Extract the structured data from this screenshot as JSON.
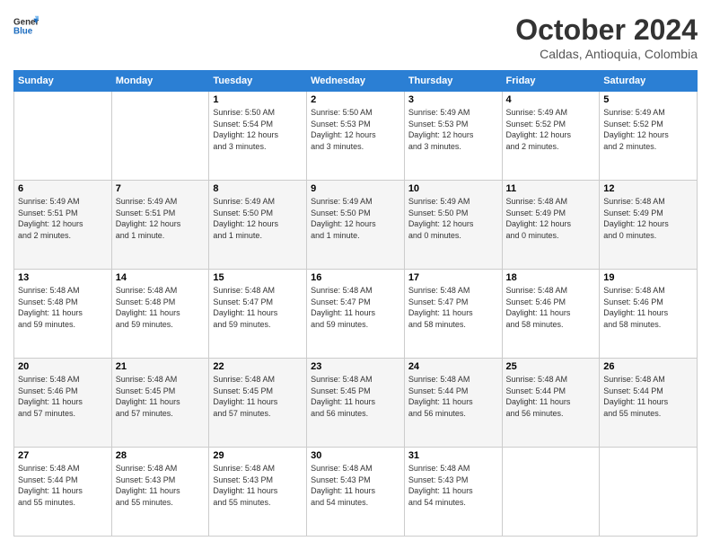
{
  "header": {
    "logo_line1": "General",
    "logo_line2": "Blue",
    "month_title": "October 2024",
    "location": "Caldas, Antioquia, Colombia"
  },
  "weekdays": [
    "Sunday",
    "Monday",
    "Tuesday",
    "Wednesday",
    "Thursday",
    "Friday",
    "Saturday"
  ],
  "weeks": [
    [
      {
        "day": "",
        "info": ""
      },
      {
        "day": "",
        "info": ""
      },
      {
        "day": "1",
        "info": "Sunrise: 5:50 AM\nSunset: 5:54 PM\nDaylight: 12 hours\nand 3 minutes."
      },
      {
        "day": "2",
        "info": "Sunrise: 5:50 AM\nSunset: 5:53 PM\nDaylight: 12 hours\nand 3 minutes."
      },
      {
        "day": "3",
        "info": "Sunrise: 5:49 AM\nSunset: 5:53 PM\nDaylight: 12 hours\nand 3 minutes."
      },
      {
        "day": "4",
        "info": "Sunrise: 5:49 AM\nSunset: 5:52 PM\nDaylight: 12 hours\nand 2 minutes."
      },
      {
        "day": "5",
        "info": "Sunrise: 5:49 AM\nSunset: 5:52 PM\nDaylight: 12 hours\nand 2 minutes."
      }
    ],
    [
      {
        "day": "6",
        "info": "Sunrise: 5:49 AM\nSunset: 5:51 PM\nDaylight: 12 hours\nand 2 minutes."
      },
      {
        "day": "7",
        "info": "Sunrise: 5:49 AM\nSunset: 5:51 PM\nDaylight: 12 hours\nand 1 minute."
      },
      {
        "day": "8",
        "info": "Sunrise: 5:49 AM\nSunset: 5:50 PM\nDaylight: 12 hours\nand 1 minute."
      },
      {
        "day": "9",
        "info": "Sunrise: 5:49 AM\nSunset: 5:50 PM\nDaylight: 12 hours\nand 1 minute."
      },
      {
        "day": "10",
        "info": "Sunrise: 5:49 AM\nSunset: 5:50 PM\nDaylight: 12 hours\nand 0 minutes."
      },
      {
        "day": "11",
        "info": "Sunrise: 5:48 AM\nSunset: 5:49 PM\nDaylight: 12 hours\nand 0 minutes."
      },
      {
        "day": "12",
        "info": "Sunrise: 5:48 AM\nSunset: 5:49 PM\nDaylight: 12 hours\nand 0 minutes."
      }
    ],
    [
      {
        "day": "13",
        "info": "Sunrise: 5:48 AM\nSunset: 5:48 PM\nDaylight: 11 hours\nand 59 minutes."
      },
      {
        "day": "14",
        "info": "Sunrise: 5:48 AM\nSunset: 5:48 PM\nDaylight: 11 hours\nand 59 minutes."
      },
      {
        "day": "15",
        "info": "Sunrise: 5:48 AM\nSunset: 5:47 PM\nDaylight: 11 hours\nand 59 minutes."
      },
      {
        "day": "16",
        "info": "Sunrise: 5:48 AM\nSunset: 5:47 PM\nDaylight: 11 hours\nand 59 minutes."
      },
      {
        "day": "17",
        "info": "Sunrise: 5:48 AM\nSunset: 5:47 PM\nDaylight: 11 hours\nand 58 minutes."
      },
      {
        "day": "18",
        "info": "Sunrise: 5:48 AM\nSunset: 5:46 PM\nDaylight: 11 hours\nand 58 minutes."
      },
      {
        "day": "19",
        "info": "Sunrise: 5:48 AM\nSunset: 5:46 PM\nDaylight: 11 hours\nand 58 minutes."
      }
    ],
    [
      {
        "day": "20",
        "info": "Sunrise: 5:48 AM\nSunset: 5:46 PM\nDaylight: 11 hours\nand 57 minutes."
      },
      {
        "day": "21",
        "info": "Sunrise: 5:48 AM\nSunset: 5:45 PM\nDaylight: 11 hours\nand 57 minutes."
      },
      {
        "day": "22",
        "info": "Sunrise: 5:48 AM\nSunset: 5:45 PM\nDaylight: 11 hours\nand 57 minutes."
      },
      {
        "day": "23",
        "info": "Sunrise: 5:48 AM\nSunset: 5:45 PM\nDaylight: 11 hours\nand 56 minutes."
      },
      {
        "day": "24",
        "info": "Sunrise: 5:48 AM\nSunset: 5:44 PM\nDaylight: 11 hours\nand 56 minutes."
      },
      {
        "day": "25",
        "info": "Sunrise: 5:48 AM\nSunset: 5:44 PM\nDaylight: 11 hours\nand 56 minutes."
      },
      {
        "day": "26",
        "info": "Sunrise: 5:48 AM\nSunset: 5:44 PM\nDaylight: 11 hours\nand 55 minutes."
      }
    ],
    [
      {
        "day": "27",
        "info": "Sunrise: 5:48 AM\nSunset: 5:44 PM\nDaylight: 11 hours\nand 55 minutes."
      },
      {
        "day": "28",
        "info": "Sunrise: 5:48 AM\nSunset: 5:43 PM\nDaylight: 11 hours\nand 55 minutes."
      },
      {
        "day": "29",
        "info": "Sunrise: 5:48 AM\nSunset: 5:43 PM\nDaylight: 11 hours\nand 55 minutes."
      },
      {
        "day": "30",
        "info": "Sunrise: 5:48 AM\nSunset: 5:43 PM\nDaylight: 11 hours\nand 54 minutes."
      },
      {
        "day": "31",
        "info": "Sunrise: 5:48 AM\nSunset: 5:43 PM\nDaylight: 11 hours\nand 54 minutes."
      },
      {
        "day": "",
        "info": ""
      },
      {
        "day": "",
        "info": ""
      }
    ]
  ]
}
